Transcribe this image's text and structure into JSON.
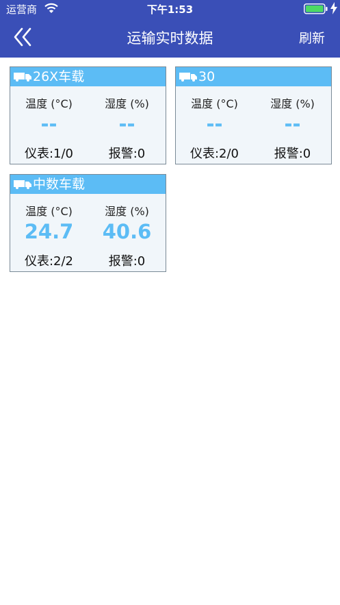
{
  "status_bar": {
    "carrier": "运营商",
    "time": "下午1:53"
  },
  "nav": {
    "title": "运输实时数据",
    "refresh_label": "刷新"
  },
  "colors": {
    "header_bg": "#3a4fb7",
    "accent": "#5cbcf5",
    "card_bg": "#f1f6fa"
  },
  "cards": [
    {
      "name": "26X车载",
      "temp_label": "温度 (°C)",
      "humidity_label": "湿度 (%)",
      "temp_value": "--",
      "humidity_value": "--",
      "meters": "仪表:1/0",
      "alarms": "报警:0"
    },
    {
      "name": "30",
      "temp_label": "温度 (°C)",
      "humidity_label": "湿度 (%)",
      "temp_value": "--",
      "humidity_value": "--",
      "meters": "仪表:2/0",
      "alarms": "报警:0"
    },
    {
      "name": "中数车载",
      "temp_label": "温度 (°C)",
      "humidity_label": "湿度 (%)",
      "temp_value": "24.7",
      "humidity_value": "40.6",
      "meters": "仪表:2/2",
      "alarms": "报警:0"
    }
  ]
}
